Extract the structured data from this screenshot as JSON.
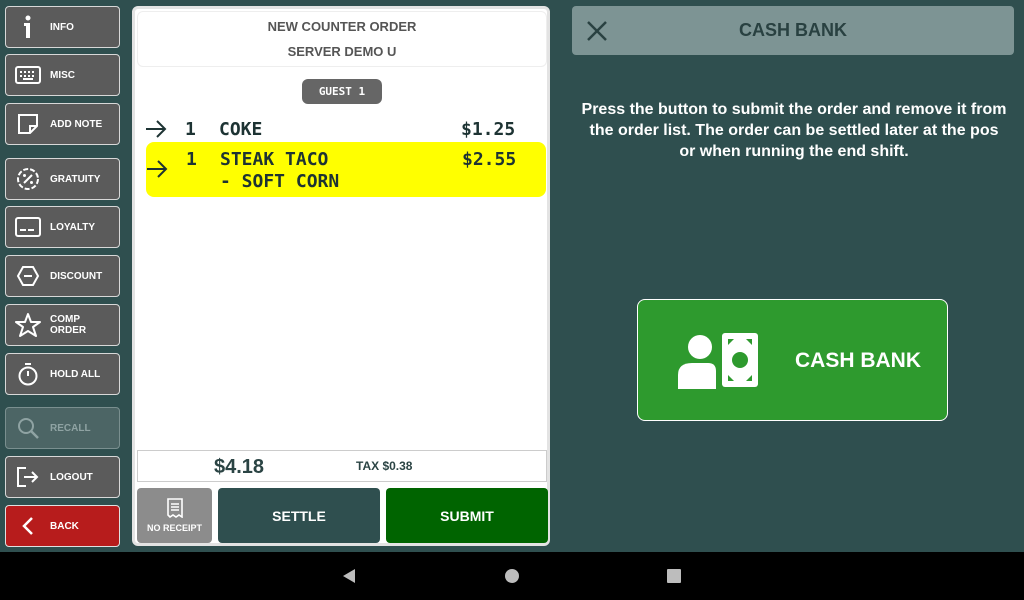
{
  "sidebar": {
    "items": [
      {
        "label": "INFO",
        "icon": "info-icon"
      },
      {
        "label": "MISC",
        "icon": "keyboard-icon"
      },
      {
        "label": "ADD NOTE",
        "icon": "note-icon"
      },
      {
        "label": "GRATUITY",
        "icon": "percent-badge-icon"
      },
      {
        "label": "LOYALTY",
        "icon": "card-icon"
      },
      {
        "label": "DISCOUNT",
        "icon": "discount-tag-icon"
      },
      {
        "label": "COMP\nORDER",
        "icon": "star-icon"
      },
      {
        "label": "HOLD ALL",
        "icon": "stopwatch-icon"
      },
      {
        "label": "RECALL",
        "icon": "search-icon",
        "disabled": true
      },
      {
        "label": "LOGOUT",
        "icon": "logout-icon"
      },
      {
        "label": "BACK",
        "icon": "chevron-left-icon"
      }
    ]
  },
  "order": {
    "title": "NEW COUNTER ORDER",
    "server": "SERVER DEMO U",
    "guest": "GUEST 1",
    "items": [
      {
        "qty": "1",
        "name": "COKE",
        "price": "$1.25"
      },
      {
        "qty": "1",
        "name": "STEAK TACO",
        "modifier": "- SOFT CORN",
        "price": "$2.55"
      }
    ],
    "total": "$4.18",
    "tax": "TAX $0.38",
    "no_receipt_label": "NO RECEIPT",
    "settle_label": "SETTLE",
    "submit_label": "SUBMIT"
  },
  "panel": {
    "title": "CASH BANK",
    "info": "Press the button to submit the order and remove it from the order list. The order can be settled later at the pos or when running the end shift.",
    "button_label": "CASH BANK"
  },
  "colors": {
    "background": "#2f4f4f",
    "selected_item": "#ffff00",
    "submit": "#006400",
    "cash_bank_button": "#2e9a2e",
    "back_button": "#b71c1c"
  }
}
